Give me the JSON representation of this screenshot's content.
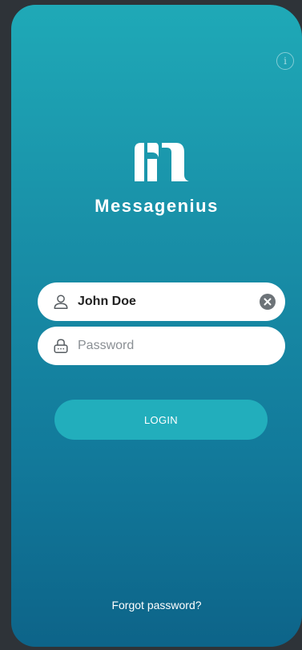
{
  "app": {
    "brand_name": "Messagenius"
  },
  "info": {
    "icon": "info-icon",
    "glyph": "i"
  },
  "login_form": {
    "username_value": "John Doe",
    "username_icon": "user-icon",
    "clear_icon": "clear-icon",
    "password_placeholder": "Password",
    "password_icon": "lock-icon",
    "login_label": "LOGIN",
    "forgot_label": "Forgot password?"
  },
  "colors": {
    "gradient_top": "#1fa9b7",
    "gradient_bottom": "#0d6489",
    "button": "#22aebc",
    "field_bg": "#ffffff",
    "page_bg": "#2e3338"
  }
}
